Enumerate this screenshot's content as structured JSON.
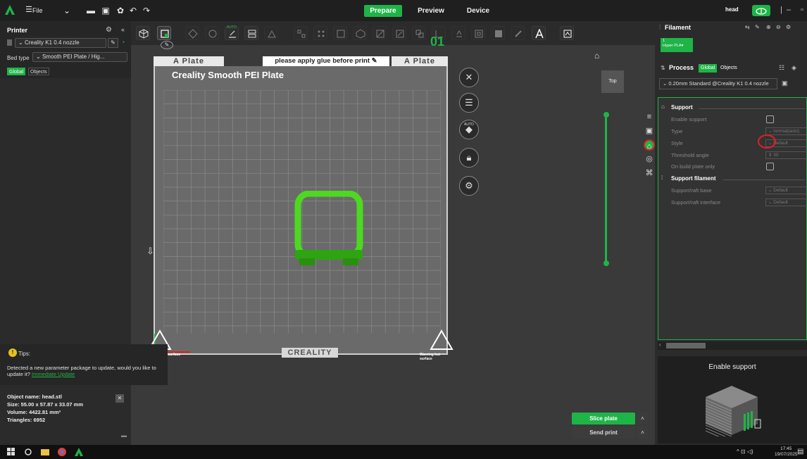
{
  "topbar": {
    "file_label": "File",
    "tabs": [
      {
        "label": "Prepare",
        "active": true
      },
      {
        "label": "Preview",
        "active": false
      },
      {
        "label": "Device",
        "active": false
      }
    ],
    "user": "head"
  },
  "printer_panel": {
    "title": "Printer",
    "printer": "Creality K1 0.4 nozzle",
    "bed_type_label": "Bed type",
    "bed_type": "Smooth PEI Plate / Hig...",
    "segments": [
      "Global",
      "Objects"
    ]
  },
  "toolbar": {
    "auto_label": "AUTO",
    "plate_number": "01"
  },
  "plate": {
    "left_label": "A Plate",
    "note": "please apply glue before print",
    "right_label": "A Plate",
    "bed_title": "Creality Smooth PEI Plate",
    "footer_brand": "CREALITY",
    "warn_left": "Warning hot surface",
    "warn_right": "Warning hot surface"
  },
  "view": {
    "top_label": "Top",
    "auto_label": "AUTO"
  },
  "tips": {
    "title": "Tips:",
    "text": "Detected a new parameter package to update, would you like to update it?",
    "link": "Immediate Update"
  },
  "object_info": {
    "name": "Object name: head.stl",
    "size": "Size: 55.00 x 57.87 x 33.07 mm",
    "volume": "Volume: 4422.81 mm³",
    "triangles": "Triangles: 6952"
  },
  "actions": {
    "slice": "Slice plate",
    "send": "Send print"
  },
  "filament": {
    "title": "Filament",
    "slot": "1",
    "name": "Hyper PLA"
  },
  "process": {
    "title": "Process",
    "segments": [
      "Global",
      "Objects"
    ],
    "preset": "0.20mm Standard @Creality K1 0.4 nozzle",
    "support_title": "Support",
    "options": [
      {
        "label": "Enable support",
        "kind": "checkbox"
      },
      {
        "label": "Type",
        "kind": "select",
        "value": "normal(auto)"
      },
      {
        "label": "Style",
        "kind": "select",
        "value": "Default"
      },
      {
        "label": "Threshold angle",
        "kind": "spin",
        "value": "30"
      },
      {
        "label": "On build plate only",
        "kind": "checkbox"
      }
    ],
    "support_filament_title": "Support filament",
    "filament_options": [
      {
        "label": "Support/raft base",
        "value": "Default"
      },
      {
        "label": "Support/raft interface",
        "value": "Default"
      }
    ]
  },
  "preview": {
    "title": "Enable support"
  },
  "taskbar": {
    "time": "17:45",
    "date": "19/07/2025"
  },
  "colors": {
    "accent": "#1fb447",
    "highlight": "#e02020"
  }
}
